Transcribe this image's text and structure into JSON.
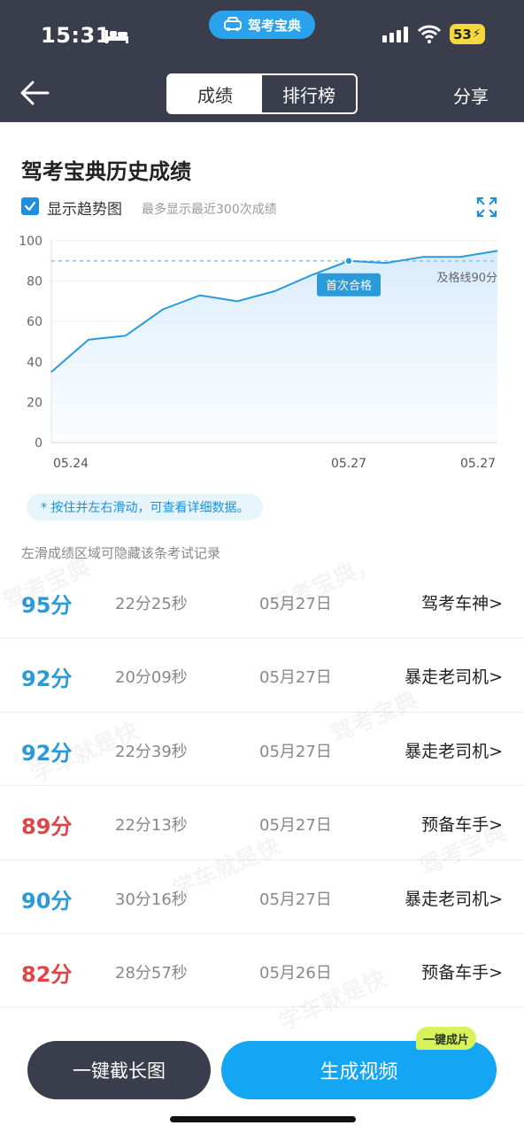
{
  "status_bar": {
    "time": "15:31",
    "app_badge": "驾考宝典",
    "battery": "53"
  },
  "header": {
    "tabs": [
      "成绩",
      "排行榜"
    ],
    "active_tab": "成绩",
    "share_label": "分享"
  },
  "page": {
    "title": "驾考宝典历史成绩",
    "trend_checkbox_label": "显示趋势图",
    "trend_checked": true,
    "trend_hint": "最多显示最近300次成绩",
    "swipe_tip": "* 按住并左右滑动，可查看详细数据。",
    "hide_tip": "左滑成绩区域可隐藏该条考试记录"
  },
  "chart_data": {
    "type": "area",
    "y_ticks": [
      "0",
      "20",
      "40",
      "60",
      "80",
      "100"
    ],
    "ylim": [
      0,
      100
    ],
    "x_tick_labels": [
      "05.24",
      "05.27",
      "05.27"
    ],
    "values": [
      35,
      51,
      53,
      66,
      73,
      70,
      75,
      83,
      90,
      89,
      92,
      92,
      95
    ],
    "pass_line_value": 90,
    "pass_line_label": "及格线90分",
    "first_pass_label": "首次合格",
    "first_pass_index": 8,
    "line_color": "#2b9ad8",
    "grid": true
  },
  "records": [
    {
      "score": "95分",
      "pass": true,
      "duration": "22分25秒",
      "date": "05月27日",
      "title": "驾考车神>"
    },
    {
      "score": "92分",
      "pass": true,
      "duration": "20分09秒",
      "date": "05月27日",
      "title": "暴走老司机>"
    },
    {
      "score": "92分",
      "pass": true,
      "duration": "22分39秒",
      "date": "05月27日",
      "title": "暴走老司机>"
    },
    {
      "score": "89分",
      "pass": false,
      "duration": "22分13秒",
      "date": "05月27日",
      "title": "预备车手>"
    },
    {
      "score": "90分",
      "pass": true,
      "duration": "30分16秒",
      "date": "05月27日",
      "title": "暴走老司机>"
    },
    {
      "score": "82分",
      "pass": false,
      "duration": "28分57秒",
      "date": "05月26日",
      "title": "预备车手>"
    }
  ],
  "watermarks": [
    "驾考宝典",
    "学车就是快",
    "驾考宝典，",
    "驾考宝典",
    "学车就是快",
    "驾考宝典",
    "学车就是快"
  ],
  "buttons": {
    "long_screenshot": "一键截长图",
    "make_video": "生成视频",
    "video_badge": "一键成片"
  },
  "colors": {
    "header_bg": "#3a3e4c",
    "accent_blue": "#2b9ad8",
    "fail_red": "#e0454a",
    "primary_button": "#14a6f2",
    "badge_green": "#d8f259"
  }
}
